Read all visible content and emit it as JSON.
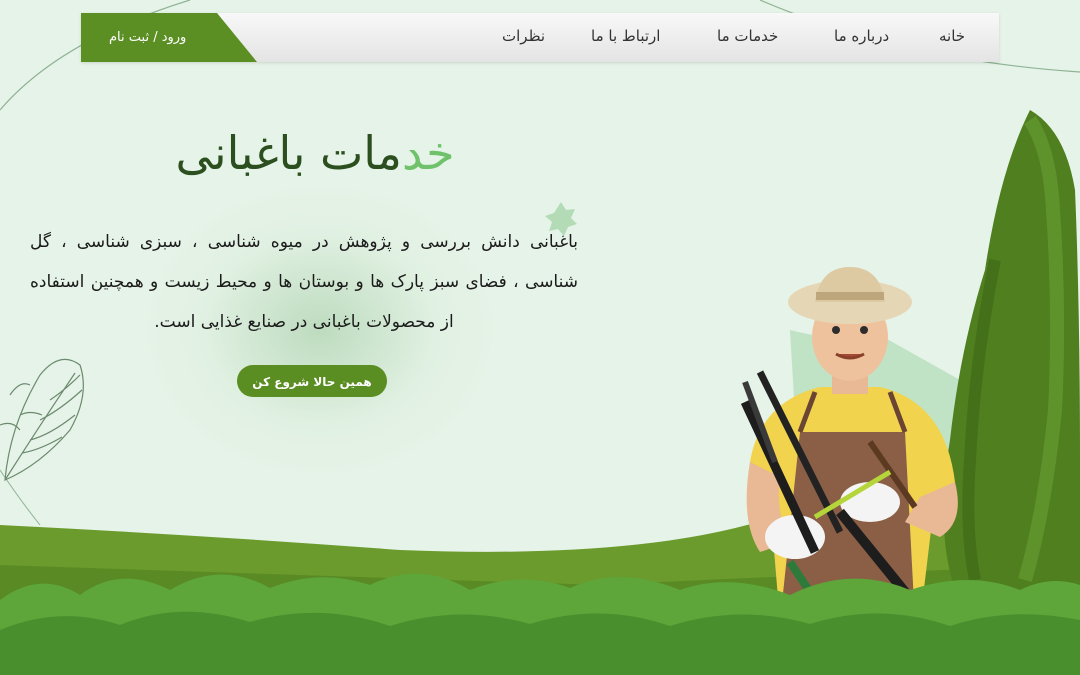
{
  "nav": {
    "login_label": "ورود / ثبت نام",
    "items": [
      {
        "label": "خانه"
      },
      {
        "label": "درباره ما"
      },
      {
        "label": "خدمات ما"
      },
      {
        "label": "ارتباط با ما"
      },
      {
        "label": "نظرات"
      }
    ]
  },
  "hero": {
    "title_accent": "خد",
    "title_main": "مات باغبانی",
    "description": "باغبانی دانش بررسی و پژوهش در میوه شناسی ، سبزی شناسی ، گل شناسی ، فضای سبز پارک ها و بوستان ها و محیط زیست و همچنین استفاده از محصولات باغبانی در صنایع غذایی است.",
    "cta_label": "همین حالا شروع کن"
  },
  "colors": {
    "background": "#e6f3e8",
    "brand_green": "#5b8f24",
    "title_dark": "#2c4f1f",
    "title_accent": "#6fc16a"
  }
}
